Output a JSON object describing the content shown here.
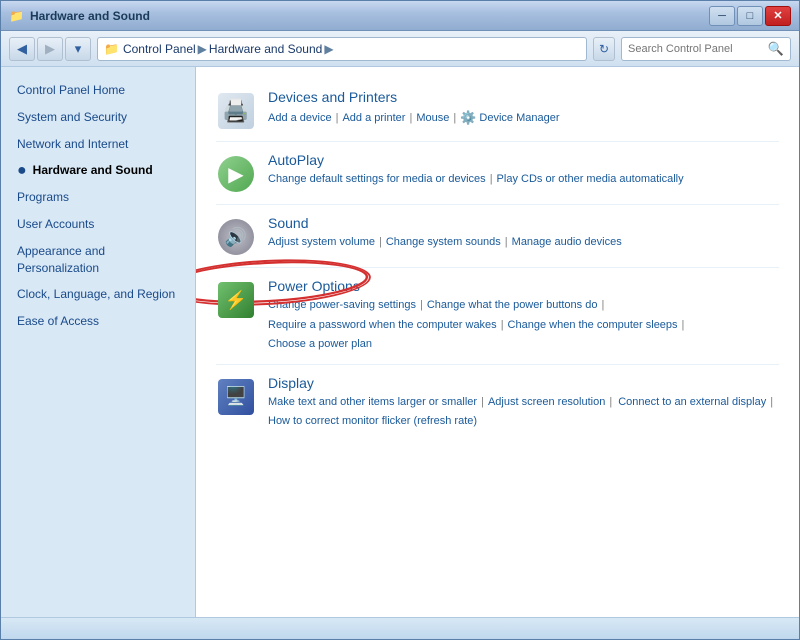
{
  "window": {
    "title": "Hardware and Sound",
    "controls": {
      "minimize": "─",
      "maximize": "□",
      "close": "✕"
    }
  },
  "addressbar": {
    "back_label": "◀",
    "forward_label": "▶",
    "dropdown_label": "▾",
    "refresh_label": "↻",
    "path": [
      "Control Panel",
      "Hardware and Sound"
    ],
    "search_placeholder": "Search Control Panel"
  },
  "sidebar": {
    "items": [
      {
        "label": "Control Panel Home",
        "active": false,
        "bullet": false
      },
      {
        "label": "System and Security",
        "active": false,
        "bullet": false
      },
      {
        "label": "Network and Internet",
        "active": false,
        "bullet": false
      },
      {
        "label": "Hardware and Sound",
        "active": true,
        "bullet": true
      },
      {
        "label": "Programs",
        "active": false,
        "bullet": false
      },
      {
        "label": "User Accounts",
        "active": false,
        "bullet": false
      },
      {
        "label": "Appearance and Personalization",
        "active": false,
        "bullet": false
      },
      {
        "label": "Clock, Language, and Region",
        "active": false,
        "bullet": false
      },
      {
        "label": "Ease of Access",
        "active": false,
        "bullet": false
      }
    ]
  },
  "sections": [
    {
      "id": "devices",
      "title": "Devices and Printers",
      "links": [
        "Add a device",
        "Add a printer",
        "Mouse",
        "Device Manager"
      ]
    },
    {
      "id": "autoplay",
      "title": "AutoPlay",
      "links": [
        "Change default settings for media or devices",
        "Play CDs or other media automatically"
      ]
    },
    {
      "id": "sound",
      "title": "Sound",
      "links": [
        "Adjust system volume",
        "Change system sounds",
        "Manage audio devices"
      ]
    },
    {
      "id": "power",
      "title": "Power Options",
      "links": [
        "Change power-saving settings",
        "Change what the power buttons do",
        "Require a password when the computer wakes",
        "Change when the computer sleeps",
        "Choose a power plan"
      ]
    },
    {
      "id": "display",
      "title": "Display",
      "links": [
        "Make text and other items larger or smaller",
        "Adjust screen resolution",
        "Connect to an external display",
        "How to correct monitor flicker (refresh rate)"
      ]
    }
  ]
}
